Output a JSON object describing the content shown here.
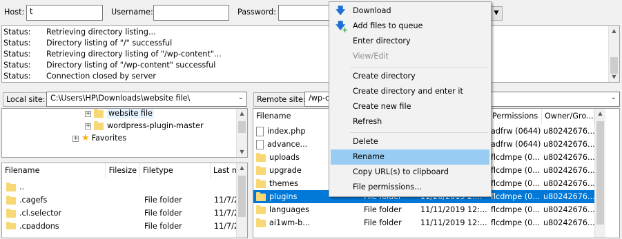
{
  "quickconnect": {
    "host_label": "Host:",
    "host_value": "t",
    "username_label": "Username:",
    "username_value": "",
    "password_label": "Password:",
    "password_value": ""
  },
  "log": [
    {
      "k": "Status:",
      "v": "Retrieving directory listing..."
    },
    {
      "k": "Status:",
      "v": "Directory listing of \"/\" successful"
    },
    {
      "k": "Status:",
      "v": "Retrieving directory listing of \"/wp-content\"..."
    },
    {
      "k": "Status:",
      "v": "Directory listing of \"/wp-content\" successful"
    },
    {
      "k": "Status:",
      "v": "Connection closed by server"
    }
  ],
  "local": {
    "site_label": "Local site:",
    "site_path": "C:\\Users\\HP\\Downloads\\website file\\",
    "tree": [
      {
        "label": "website file"
      },
      {
        "label": "wordpress-plugin-master"
      },
      {
        "label": "Favorites"
      }
    ],
    "headers": [
      "Filename",
      "Filesize",
      "Filetype",
      "Last m"
    ],
    "files": [
      {
        "name": "..",
        "type": "",
        "date": ""
      },
      {
        "name": ".cagefs",
        "type": "File folder",
        "date": "11/7/2"
      },
      {
        "name": ".cl.selector",
        "type": "File folder",
        "date": "11/7/2"
      },
      {
        "name": ".cpaddons",
        "type": "File folder",
        "date": "11/7/2"
      }
    ]
  },
  "remote": {
    "site_label": "Remote site:",
    "site_path": "/wp-c",
    "headers": [
      "Filename",
      "Permissions",
      "Owner/Gro..."
    ],
    "files": [
      {
        "name": "index.php",
        "icon": "file",
        "type": "",
        "date": "",
        "perm": "adfrw (0644)",
        "owner": "u80242676..."
      },
      {
        "name": "advance...",
        "icon": "file",
        "type": "",
        "date": "",
        "perm": "adfrw (0644)",
        "owner": "u80242676..."
      },
      {
        "name": "uploads",
        "icon": "folder",
        "type": "",
        "date": "",
        "perm": "flcdmpe (0...",
        "owner": "u80242676..."
      },
      {
        "name": "upgrade",
        "icon": "folder",
        "type": "",
        "date": "",
        "perm": "flcdmpe (0...",
        "owner": "u80242676..."
      },
      {
        "name": "themes",
        "icon": "folder",
        "type": "",
        "date": "",
        "perm": "flcdmpe (0...",
        "owner": "u80242676..."
      },
      {
        "name": "plugins",
        "icon": "folder",
        "type": "File folder",
        "date": "11/26/2019 2:...",
        "perm": "flcdmpe (0...",
        "owner": "u80242676...",
        "selected": true
      },
      {
        "name": "languages",
        "icon": "folder",
        "type": "File folder",
        "date": "11/11/2019 12:...",
        "perm": "flcdmpe (0...",
        "owner": "u80242676..."
      },
      {
        "name": "ai1wm-b...",
        "icon": "folder",
        "type": "File folder",
        "date": "11/11/2019 12:...",
        "perm": "flcdmpe (0...",
        "owner": "u80242676..."
      }
    ]
  },
  "context_menu": {
    "items": [
      {
        "label": "Download",
        "icon": "download-arrow-icon"
      },
      {
        "label": "Add files to queue",
        "icon": "add-to-queue-icon"
      },
      {
        "label": "Enter directory"
      },
      {
        "label": "View/Edit",
        "disabled": true
      },
      {
        "label": "Create directory"
      },
      {
        "label": "Create directory and enter it"
      },
      {
        "label": "Create new file"
      },
      {
        "label": "Refresh"
      },
      {
        "label": "Delete"
      },
      {
        "label": "Rename",
        "highlighted": true
      },
      {
        "label": "Copy URL(s) to clipboard"
      },
      {
        "label": "File permissions..."
      }
    ]
  },
  "colors": {
    "selection": "#0078d7",
    "menu_highlight": "#99ccf3",
    "folder": "#f8d775",
    "download_icon": "#1e6fd6",
    "add_icon_plus": "#2aa52a"
  }
}
